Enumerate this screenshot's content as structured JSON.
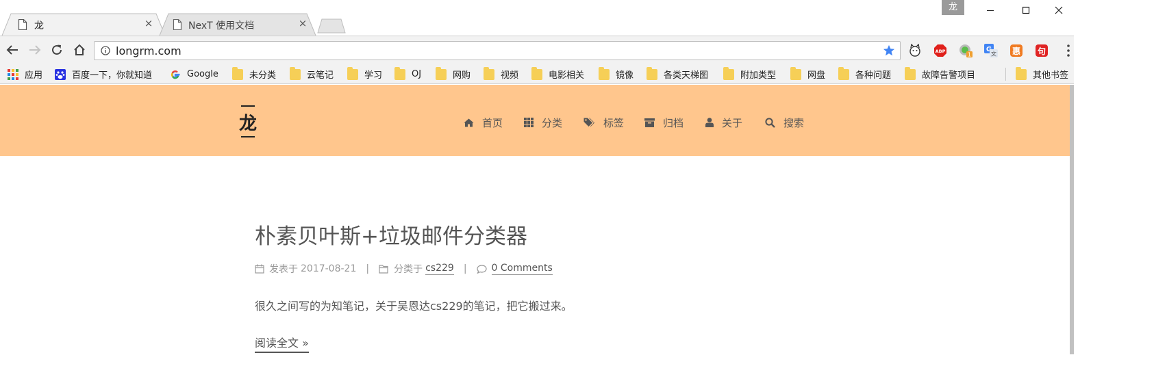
{
  "browser": {
    "tabs": [
      {
        "title": "龙",
        "active": true
      },
      {
        "title": "NexT 使用文档",
        "active": false
      }
    ],
    "tab_close_glyph": "×",
    "profile_badge": "龙",
    "url": "longrm.com",
    "bookmarks": [
      {
        "label": "应用",
        "icon": "apps-grid-icon"
      },
      {
        "label": "百度一下，你就知道",
        "icon": "baidu-paw-icon"
      },
      {
        "label": "Google",
        "icon": "google-g-icon"
      },
      {
        "label": "未分类",
        "icon": "folder-icon"
      },
      {
        "label": "云笔记",
        "icon": "folder-icon"
      },
      {
        "label": "学习",
        "icon": "folder-icon"
      },
      {
        "label": "OJ",
        "icon": "folder-icon"
      },
      {
        "label": "网购",
        "icon": "folder-icon"
      },
      {
        "label": "视频",
        "icon": "folder-icon"
      },
      {
        "label": "电影相关",
        "icon": "folder-icon"
      },
      {
        "label": "镜像",
        "icon": "folder-icon"
      },
      {
        "label": "各类天梯图",
        "icon": "folder-icon"
      },
      {
        "label": "附加类型",
        "icon": "folder-icon"
      },
      {
        "label": "网盘",
        "icon": "folder-icon"
      },
      {
        "label": "各种问题",
        "icon": "folder-icon"
      },
      {
        "label": "故障告警项目",
        "icon": "folder-icon"
      }
    ],
    "other_bookmarks": "其他书签",
    "extensions": [
      {
        "name": "cat-extension-icon"
      },
      {
        "name": "adblock-plus-icon",
        "badge": "ABP"
      },
      {
        "name": "green-status-extension-icon",
        "badge": "1"
      },
      {
        "name": "google-translate-icon"
      },
      {
        "name": "orange-extension-icon"
      },
      {
        "name": "red-extension-icon"
      }
    ]
  },
  "site": {
    "title": "龙",
    "menu": [
      {
        "label": "首页",
        "icon": "home-icon"
      },
      {
        "label": "分类",
        "icon": "grid-icon"
      },
      {
        "label": "标签",
        "icon": "tags-icon"
      },
      {
        "label": "归档",
        "icon": "archive-icon"
      },
      {
        "label": "关于",
        "icon": "user-icon"
      },
      {
        "label": "搜索",
        "icon": "search-icon"
      }
    ],
    "header_color": "#ffc68d"
  },
  "post": {
    "title": "朴素贝叶斯+垃圾邮件分类器",
    "posted_label": "发表于",
    "date": "2017-08-21",
    "divider": "|",
    "category_label": "分类于",
    "category": "cs229",
    "comments": "0 Comments",
    "excerpt": "很久之间写的为知笔记，关于吴恩达cs229的笔记，把它搬过来。",
    "read_more": "阅读全文 »"
  }
}
